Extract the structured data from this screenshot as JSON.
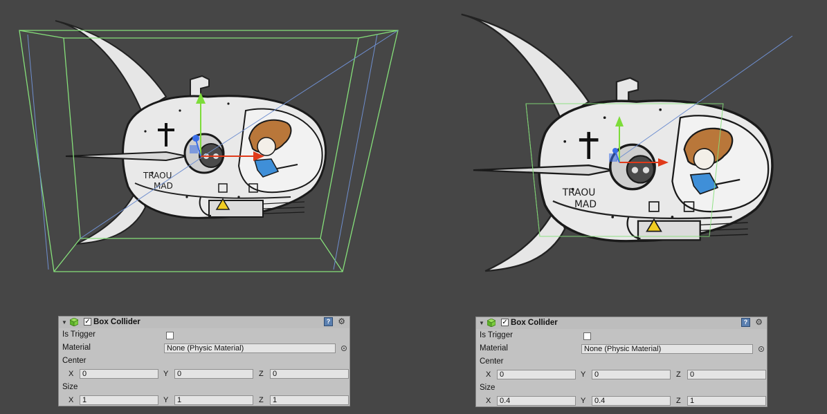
{
  "colors": {
    "viewport_bg": "#464646",
    "collider_wire": "#86e07a",
    "camera_line": "#6f8fd0",
    "inspector_bg": "#c2c2c2",
    "gizmo_y": "#7ddc3a",
    "gizmo_x": "#e03a1a",
    "gizmo_z": "#3a6ee8"
  },
  "artwork": {
    "label_line1": "TRAOU",
    "label_line2": "MAD"
  },
  "panels": [
    {
      "component_title": "Box Collider",
      "enabled": true,
      "is_trigger_label": "Is Trigger",
      "is_trigger": false,
      "material_label": "Material",
      "material_value": "None (Physic Material)",
      "center_label": "Center",
      "center": {
        "x": "0",
        "y": "0",
        "z": "0"
      },
      "size_label": "Size",
      "size": {
        "x": "1",
        "y": "1",
        "z": "1"
      },
      "axis_labels": {
        "x": "X",
        "y": "Y",
        "z": "Z"
      }
    },
    {
      "component_title": "Box Collider",
      "enabled": true,
      "is_trigger_label": "Is Trigger",
      "is_trigger": false,
      "material_label": "Material",
      "material_value": "None (Physic Material)",
      "center_label": "Center",
      "center": {
        "x": "0",
        "y": "0",
        "z": "0"
      },
      "size_label": "Size",
      "size": {
        "x": "0.4",
        "y": "0.4",
        "z": "1"
      },
      "axis_labels": {
        "x": "X",
        "y": "Y",
        "z": "Z"
      }
    }
  ],
  "icons": {
    "foldout": "triangle-down-icon",
    "component": "cube-icon",
    "help": "help-book-icon",
    "settings": "gear-icon",
    "object_picker": "object-picker-icon"
  }
}
